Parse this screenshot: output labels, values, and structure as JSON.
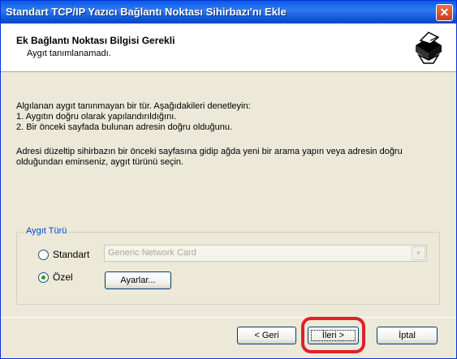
{
  "window": {
    "title": "Standart TCP/IP Yazıcı Bağlantı Noktası Sihirbazı'nı Ekle",
    "close_glyph": "✕"
  },
  "header": {
    "title": "Ek Bağlantı Noktası Bilgisi Gerekli",
    "subtitle": "Aygıt tanımlanamadı.",
    "icon": "printer-icon"
  },
  "body": {
    "line1": "Algılanan aygıt tanınmayan bir tür.  Aşağıdakileri denetleyin:",
    "line2": "1. Aygıtın doğru olarak yapılandırıldığını.",
    "line3": "2.  Bir önceki sayfada bulunan adresin doğru olduğunu.",
    "para2_line1": "Adresi düzeltip sihirbazın bir önceki sayfasına gidip ağda yeni bir arama yapın veya adresin doğru",
    "para2_line2": "olduğundan eminseniz, aygıt türünü seçin."
  },
  "device_type": {
    "group_label": "Aygıt Türü",
    "standard_label": "Standart",
    "standard_selected": false,
    "standard_value": "Generic Network Card",
    "custom_label": "Özel",
    "custom_selected": true,
    "settings_button": "Ayarlar..."
  },
  "footer": {
    "back_label": "< Geri",
    "next_label": "İleri >",
    "cancel_label": "İptal"
  },
  "colors": {
    "highlight": "#e0202a",
    "titlebar": "#0a5ae8"
  }
}
